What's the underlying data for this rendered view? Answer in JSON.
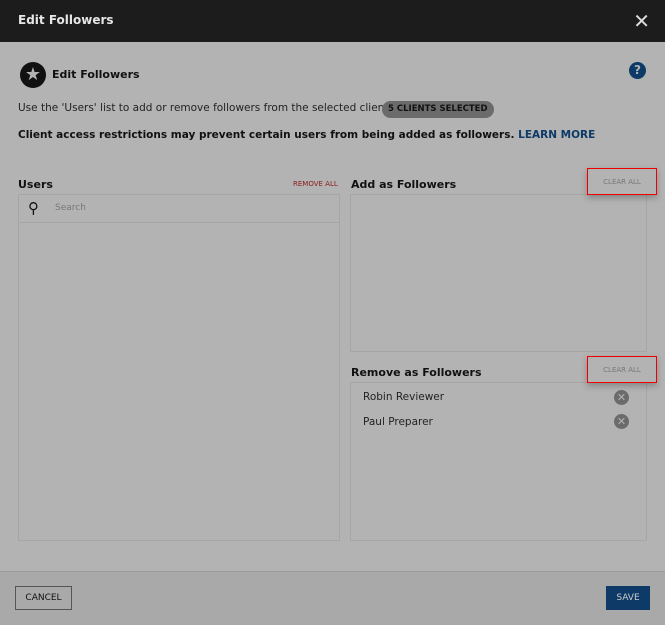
{
  "header": {
    "title": "Edit Followers",
    "close_icon": "close-icon"
  },
  "section": {
    "title": "Edit Followers",
    "icon": "star-icon",
    "help_icon": "help-icon"
  },
  "description": "Use the 'Users' list to add or remove followers from the selected client(s).",
  "badge": "5 CLIENTS SELECTED",
  "warning": "Client access restrictions may prevent certain users from being added as followers.",
  "learn_more": "LEARN MORE",
  "users": {
    "label": "Users",
    "remove_all": "REMOVE ALL",
    "search_placeholder": "Search"
  },
  "add": {
    "label": "Add as Followers",
    "clear_all": "CLEAR ALL"
  },
  "remove": {
    "label": "Remove as Followers",
    "clear_all": "CLEAR ALL",
    "items": [
      "Robin Reviewer",
      "Paul Preparer"
    ]
  },
  "footer": {
    "cancel": "CANCEL",
    "save": "SAVE"
  }
}
